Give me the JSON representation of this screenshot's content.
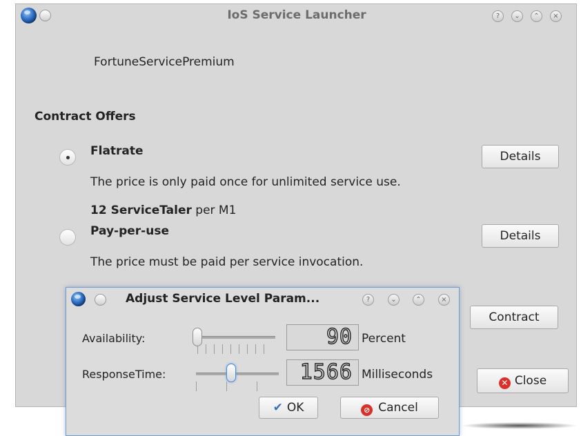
{
  "main_window": {
    "title": "IoS Service Launcher",
    "service_name": "FortuneServicePremium",
    "section_heading": "Contract Offers",
    "offers": [
      {
        "name": "Flatrate",
        "selected": true,
        "description": "The price is only paid once for unlimited service use.",
        "price_value": "12 ServiceTaler",
        "price_unit": " per M1",
        "details_label": "Details"
      },
      {
        "name": "Pay-per-use",
        "selected": false,
        "description": "The price must be paid per service invocation.",
        "details_label": "Details"
      }
    ],
    "contract_label": "Contract",
    "close_label": "Close",
    "titlebar_buttons": [
      "help-icon",
      "minimize-icon",
      "maximize-icon",
      "close-icon"
    ]
  },
  "dialog": {
    "title": "Adjust Service Level Param...",
    "params": [
      {
        "label": "Availability:",
        "value": "90",
        "unit": "Percent",
        "slider_level": 0.0
      },
      {
        "label": "ResponseTime:",
        "value": "1566",
        "unit": "Milliseconds",
        "slider_level": 0.5
      }
    ],
    "ok_label": "OK",
    "cancel_label": "Cancel",
    "titlebar_buttons": [
      "help-icon",
      "minimize-icon",
      "maximize-icon",
      "close-icon"
    ]
  },
  "colors": {
    "window_bg": "#d8d8d8",
    "focus_border": "#6f9bd1",
    "close_icon": "#d9302a",
    "ok_check": "#3a6fc0"
  }
}
